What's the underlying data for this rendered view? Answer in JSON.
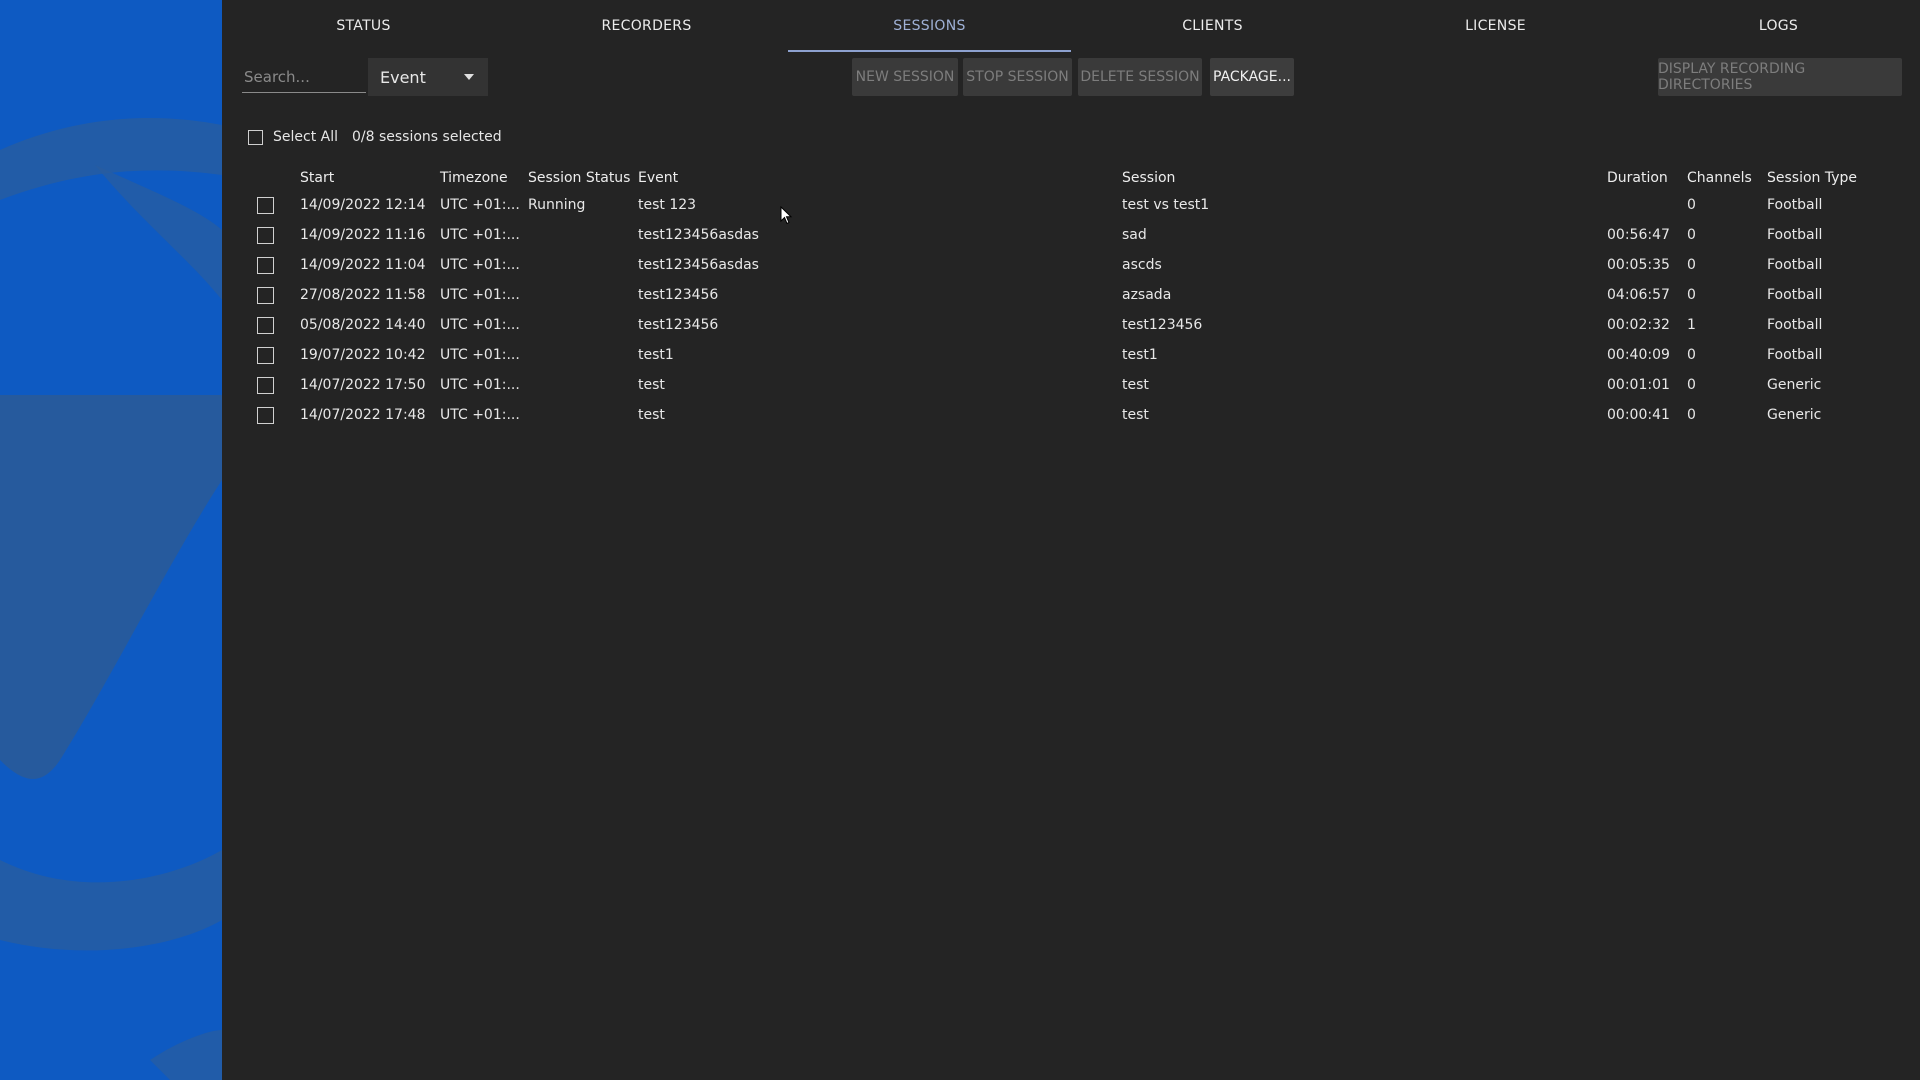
{
  "tabs": [
    {
      "label": "STATUS"
    },
    {
      "label": "RECORDERS"
    },
    {
      "label": "SESSIONS",
      "active": true
    },
    {
      "label": "CLIENTS"
    },
    {
      "label": "LICENSE"
    },
    {
      "label": "LOGS"
    }
  ],
  "toolbar": {
    "search_placeholder": "Search...",
    "filter_value": "Event",
    "new_session": "NEW SESSION",
    "stop_session": "STOP SESSION",
    "delete_session": "DELETE SESSION",
    "package": "PACKAGE...",
    "display_dirs": "DISPLAY RECORDING DIRECTORIES"
  },
  "selection": {
    "select_all_label": "Select All",
    "count_text": "0/8 sessions selected"
  },
  "table": {
    "headers": {
      "start": "Start",
      "timezone": "Timezone",
      "status": "Session Status",
      "event": "Event",
      "session": "Session",
      "duration": "Duration",
      "channels": "Channels",
      "type": "Session Type"
    },
    "rows": [
      {
        "start": "14/09/2022 12:14",
        "timezone": "UTC +01:...",
        "status": "Running",
        "event": "test 123",
        "session": "test vs test1",
        "duration": "",
        "channels": "0",
        "type": "Football"
      },
      {
        "start": "14/09/2022 11:16",
        "timezone": "UTC +01:...",
        "status": "",
        "event": "test123456asdas",
        "session": "sad",
        "duration": "00:56:47",
        "channels": "0",
        "type": "Football"
      },
      {
        "start": "14/09/2022 11:04",
        "timezone": "UTC +01:...",
        "status": "",
        "event": "test123456asdas",
        "session": "ascds",
        "duration": "00:05:35",
        "channels": "0",
        "type": "Football"
      },
      {
        "start": "27/08/2022 11:58",
        "timezone": "UTC +01:...",
        "status": "",
        "event": "test123456",
        "session": "azsada",
        "duration": "04:06:57",
        "channels": "0",
        "type": "Football"
      },
      {
        "start": "05/08/2022 14:40",
        "timezone": "UTC +01:...",
        "status": "",
        "event": "test123456",
        "session": "test123456",
        "duration": "00:02:32",
        "channels": "1",
        "type": "Football"
      },
      {
        "start": "19/07/2022 10:42",
        "timezone": "UTC +01:...",
        "status": "",
        "event": "test1",
        "session": "test1",
        "duration": "00:40:09",
        "channels": "0",
        "type": "Football"
      },
      {
        "start": "14/07/2022 17:50",
        "timezone": "UTC +01:...",
        "status": "",
        "event": "test",
        "session": "test",
        "duration": "00:01:01",
        "channels": "0",
        "type": "Generic"
      },
      {
        "start": "14/07/2022 17:48",
        "timezone": "UTC +01:...",
        "status": "",
        "event": "test",
        "session": "test",
        "duration": "00:00:41",
        "channels": "0",
        "type": "Generic"
      }
    ]
  },
  "colors": {
    "side_panel": "#0f5cc4",
    "background": "#242424",
    "active_tab": "#9fb1d6"
  }
}
